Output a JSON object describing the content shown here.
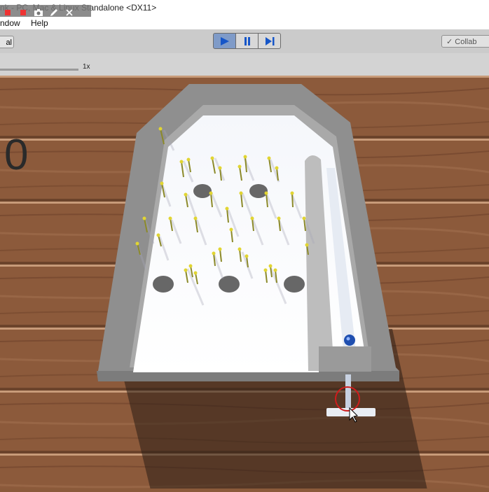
{
  "window": {
    "title": "nk - PC, Mac & Linux Standalone <DX11>"
  },
  "capture_toolbar": {
    "icons": [
      "record-icon",
      "stop-icon",
      "camera-icon",
      "pen-icon",
      "close-icon"
    ]
  },
  "menu": {
    "items": [
      "ndow",
      "Help"
    ]
  },
  "toolbar": {
    "layout_label": "al",
    "collab_label": "Collab",
    "collab_icon": "✓"
  },
  "play_controls": {
    "play": "▶",
    "pause": "❚❚",
    "step": "▶|",
    "play_active": true
  },
  "gamebar": {
    "scale_label": "1x"
  },
  "scene": {
    "score": "0"
  },
  "colors": {
    "play_active": "#7f9bc8",
    "ball": "#1f4fb0",
    "pin": "#d8c82a"
  }
}
